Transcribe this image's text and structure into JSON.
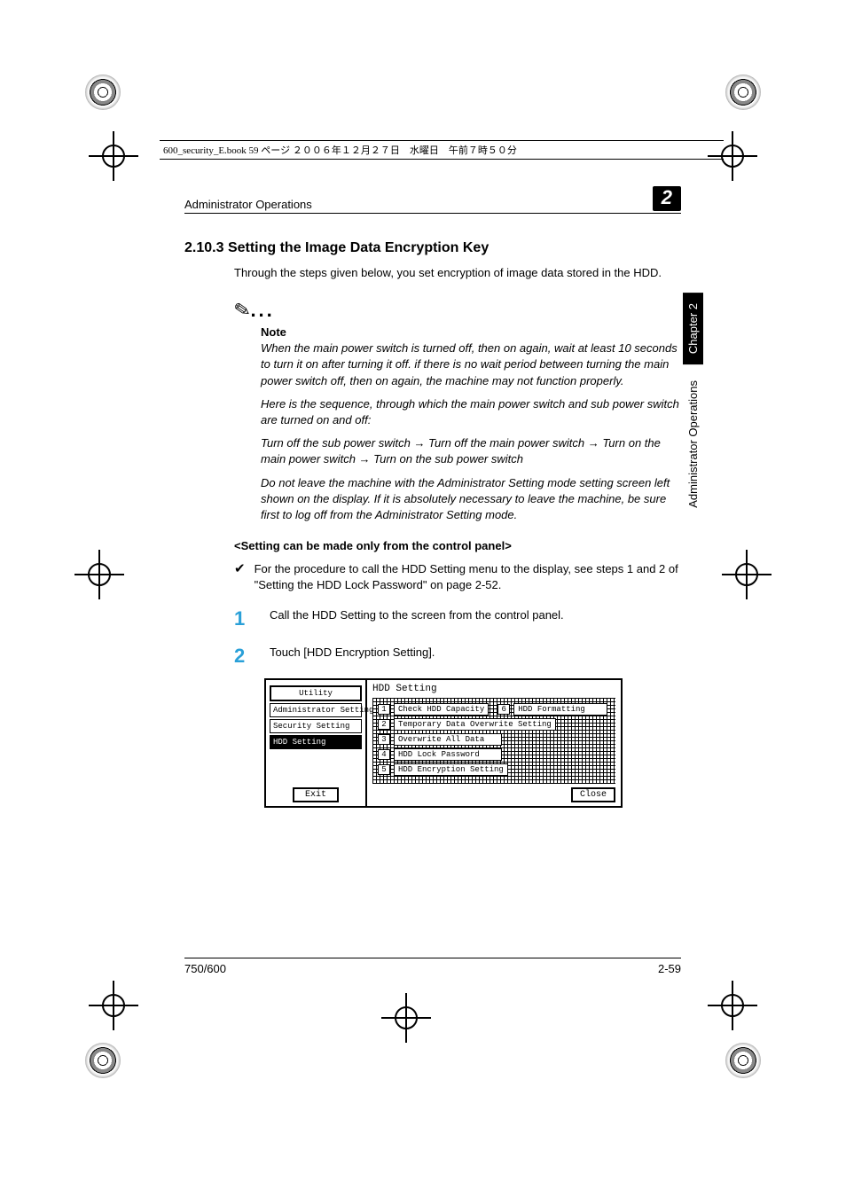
{
  "header_line": "600_security_E.book  59 ページ  ２００６年１２月２７日　水曜日　午前７時５０分",
  "running_header": "Administrator Operations",
  "chapter_number": "2",
  "side_tab_chapter": "Chapter 2",
  "side_tab_section": "Administrator Operations",
  "section_number": "2.10.3",
  "section_title": "Setting the Image Data Encryption Key",
  "intro": "Through the steps given below, you set encryption of image data stored in the HDD.",
  "note_label": "Note",
  "note_paragraphs": [
    "When the main power switch is turned off, then on again, wait at least 10 seconds to turn it on after turning it off. if there is no wait period between turning the main power switch off, then on again, the machine may not function properly.",
    "Here is the sequence, through which the main power switch and sub power switch are turned on and off:",
    "Turn off the sub power switch → Turn off the main power switch → Turn on the main power switch → Turn on the sub power switch",
    "Do not leave the machine with the Administrator Setting mode setting screen left shown on the display. If it is absolutely necessary to leave the machine, be sure first to log off from the Administrator Setting mode."
  ],
  "subheading": "<Setting can be made only from the control panel>",
  "check_text": "For the procedure to call the HDD Setting menu to the display, see steps 1 and 2 of \"Setting the HDD Lock Password\" on page 2-52.",
  "steps": [
    {
      "num": "1",
      "text": "Call the HDD Setting to the screen from the control panel."
    },
    {
      "num": "2",
      "text": "Touch [HDD Encryption Setting]."
    }
  ],
  "ui": {
    "left_title": "Utility",
    "left_items": [
      "Administrator Setting",
      "Security Setting",
      "HDD Setting"
    ],
    "left_selected_index": 2,
    "exit": "Exit",
    "right_title": "HDD Setting",
    "options": [
      "Check HDD Capacity",
      "Temporary Data Overwrite Setting",
      "Overwrite All Data",
      "HDD Lock Password",
      "HDD Encryption Setting",
      "HDD Formatting"
    ],
    "close": "Close"
  },
  "footer_left": "750/600",
  "footer_right": "2-59"
}
